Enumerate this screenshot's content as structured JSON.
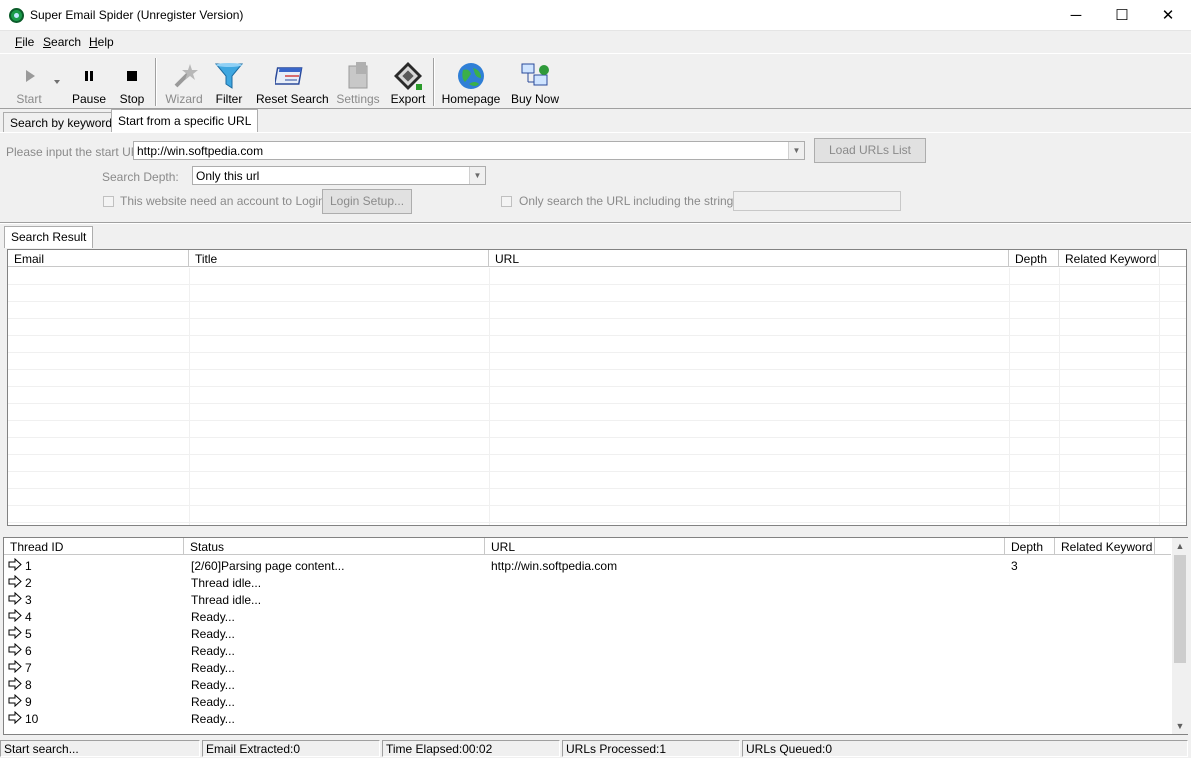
{
  "window": {
    "title": "Super Email Spider (Unregister Version)",
    "controls": [
      "─",
      "☐",
      "✕"
    ]
  },
  "menu": [
    {
      "label": "File",
      "underline": "F",
      "rest": "ile"
    },
    {
      "label": "Search",
      "underline": "S",
      "rest": "earch"
    },
    {
      "label": "Help",
      "underline": "H",
      "rest": "elp"
    }
  ],
  "toolbar": {
    "start": "Start",
    "pause": "Pause",
    "stop": "Stop",
    "wizard": "Wizard",
    "filter": "Filter",
    "reset_search": "Reset Search",
    "settings": "Settings",
    "export": "Export",
    "homepage": "Homepage",
    "buy_now": "Buy Now"
  },
  "tabs": {
    "search_by_keywords": "Search by keywords",
    "start_from_url": "Start from a specific URL"
  },
  "form": {
    "start_url_label": "Please input the start URL:",
    "start_url_value": "http://win.softpedia.com",
    "load_urls_button": "Load URLs List",
    "search_depth_label": "Search Depth:",
    "search_depth_value": "Only this url",
    "need_account_label": "This website need an account to Login",
    "login_setup_button": "Login Setup...",
    "only_search_label": "Only search the URL including the string :",
    "only_search_value": ""
  },
  "result_tab": "Search Result",
  "result_table": {
    "columns": [
      "Email",
      "Title",
      "URL",
      "Depth",
      "Related Keyword"
    ],
    "rows": []
  },
  "thread_table": {
    "columns": [
      "Thread ID",
      "Status",
      "URL",
      "Depth",
      "Related Keyword"
    ],
    "rows": [
      {
        "id": "1",
        "status": "[2/60]Parsing page content...",
        "url": "http://win.softpedia.com",
        "depth": "3",
        "keyword": ""
      },
      {
        "id": "2",
        "status": "Thread idle...",
        "url": "",
        "depth": "",
        "keyword": ""
      },
      {
        "id": "3",
        "status": "Thread idle...",
        "url": "",
        "depth": "",
        "keyword": ""
      },
      {
        "id": "4",
        "status": "Ready...",
        "url": "",
        "depth": "",
        "keyword": ""
      },
      {
        "id": "5",
        "status": "Ready...",
        "url": "",
        "depth": "",
        "keyword": ""
      },
      {
        "id": "6",
        "status": "Ready...",
        "url": "",
        "depth": "",
        "keyword": ""
      },
      {
        "id": "7",
        "status": "Ready...",
        "url": "",
        "depth": "",
        "keyword": ""
      },
      {
        "id": "8",
        "status": "Ready...",
        "url": "",
        "depth": "",
        "keyword": ""
      },
      {
        "id": "9",
        "status": "Ready...",
        "url": "",
        "depth": "",
        "keyword": ""
      },
      {
        "id": "10",
        "status": "Ready...",
        "url": "",
        "depth": "",
        "keyword": ""
      }
    ]
  },
  "statusbar": {
    "message": "Start search...",
    "email_extracted": "Email Extracted:0",
    "time_elapsed": "Time Elapsed:00:02",
    "urls_processed": "URLs Processed:1",
    "urls_queued": "URLs Queued:0"
  }
}
